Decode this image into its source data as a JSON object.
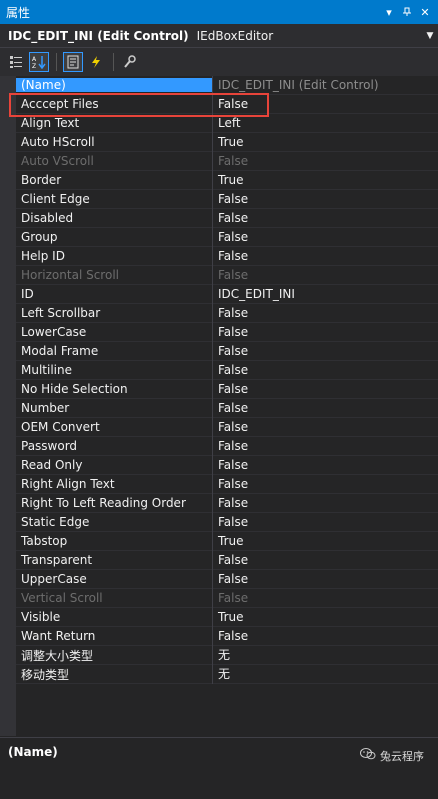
{
  "window": {
    "title": "属性"
  },
  "object": {
    "name": "IDC_EDIT_INI (Edit Control)",
    "type": "IEdBoxEditor"
  },
  "toolbar": {
    "icons": [
      "categorized-icon",
      "alphabetical-icon",
      "properties-icon",
      "events-icon",
      "property-pages-icon"
    ]
  },
  "header": {
    "name": "(Name)",
    "value": "IDC_EDIT_INI (Edit Control)"
  },
  "properties": [
    {
      "name": "Acccept Files",
      "value": "False",
      "disabled": false
    },
    {
      "name": "Align Text",
      "value": "Left",
      "disabled": false
    },
    {
      "name": "Auto HScroll",
      "value": "True",
      "disabled": false
    },
    {
      "name": "Auto VScroll",
      "value": "False",
      "disabled": true
    },
    {
      "name": "Border",
      "value": "True",
      "disabled": false
    },
    {
      "name": "Client Edge",
      "value": "False",
      "disabled": false
    },
    {
      "name": "Disabled",
      "value": "False",
      "disabled": false
    },
    {
      "name": "Group",
      "value": "False",
      "disabled": false
    },
    {
      "name": "Help ID",
      "value": "False",
      "disabled": false
    },
    {
      "name": "Horizontal Scroll",
      "value": "False",
      "disabled": true
    },
    {
      "name": "ID",
      "value": "IDC_EDIT_INI",
      "disabled": false
    },
    {
      "name": "Left Scrollbar",
      "value": "False",
      "disabled": false
    },
    {
      "name": "LowerCase",
      "value": "False",
      "disabled": false
    },
    {
      "name": "Modal Frame",
      "value": "False",
      "disabled": false
    },
    {
      "name": "Multiline",
      "value": "False",
      "disabled": false
    },
    {
      "name": "No Hide Selection",
      "value": "False",
      "disabled": false
    },
    {
      "name": "Number",
      "value": "False",
      "disabled": false
    },
    {
      "name": "OEM Convert",
      "value": "False",
      "disabled": false
    },
    {
      "name": "Password",
      "value": "False",
      "disabled": false
    },
    {
      "name": "Read Only",
      "value": "False",
      "disabled": false
    },
    {
      "name": "Right Align Text",
      "value": "False",
      "disabled": false
    },
    {
      "name": "Right To Left Reading Order",
      "value": "False",
      "disabled": false
    },
    {
      "name": "Static Edge",
      "value": "False",
      "disabled": false
    },
    {
      "name": "Tabstop",
      "value": "True",
      "disabled": false
    },
    {
      "name": "Transparent",
      "value": "False",
      "disabled": false
    },
    {
      "name": "UpperCase",
      "value": "False",
      "disabled": false
    },
    {
      "name": "Vertical Scroll",
      "value": "False",
      "disabled": true
    },
    {
      "name": "Visible",
      "value": "True",
      "disabled": false
    },
    {
      "name": "Want Return",
      "value": "False",
      "disabled": false
    },
    {
      "name": "调整大小类型",
      "value": "无",
      "disabled": false
    },
    {
      "name": "移动类型",
      "value": "无",
      "disabled": false
    }
  ],
  "description": {
    "name": "(Name)"
  },
  "watermark": {
    "text": "兔云程序"
  },
  "colors": {
    "accent": "#007acc",
    "selection": "#3399ff",
    "highlight_box": "#e8443a",
    "background": "#252526"
  }
}
